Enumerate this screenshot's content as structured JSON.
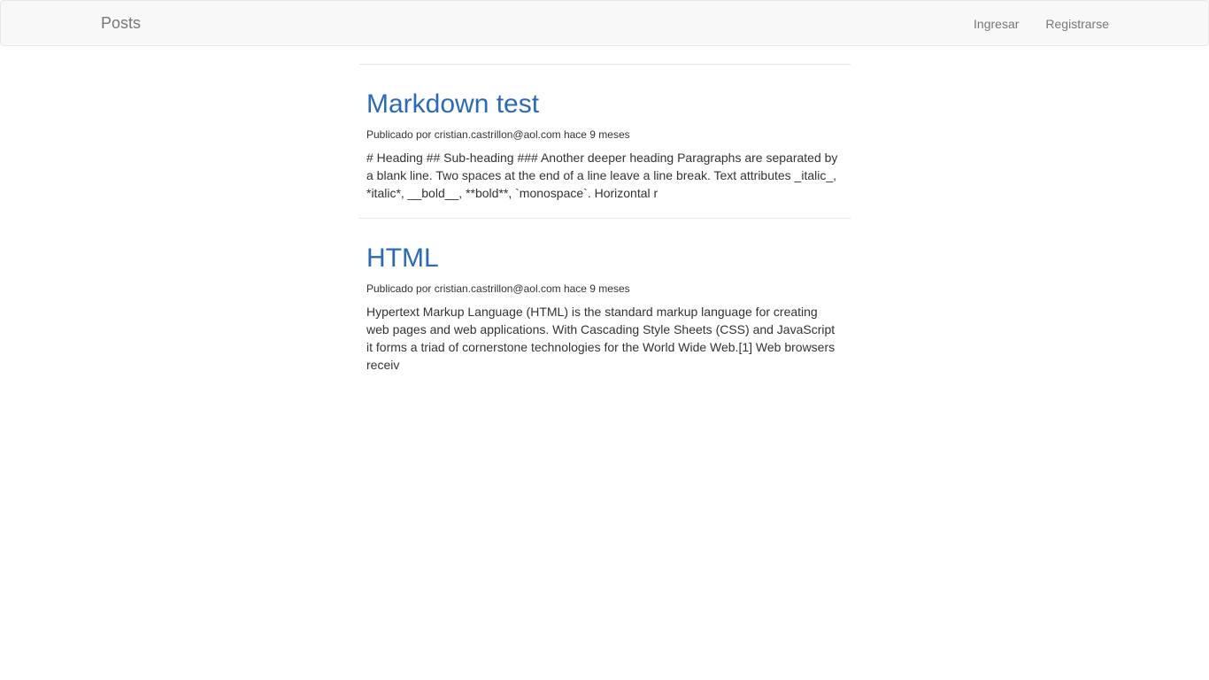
{
  "navbar": {
    "brand": "Posts",
    "links": [
      "Ingresar",
      "Registrarse"
    ]
  },
  "posts": [
    {
      "title": "Markdown test",
      "meta": "Publicado por cristian.castrillon@aol.com hace 9 meses",
      "excerpt": "# Heading ## Sub-heading ### Another deeper heading Paragraphs are separated by a blank line. Two spaces at the end of a line leave a line break. Text attributes _italic_, *italic*, __bold__, **bold**, `monospace`. Horizontal r"
    },
    {
      "title": "HTML",
      "meta": "Publicado por cristian.castrillon@aol.com hace 9 meses",
      "excerpt": "Hypertext Markup Language (HTML) is the standard markup language for creating web pages and web applications. With Cascading Style Sheets (CSS) and JavaScript it forms a triad of cornerstone technologies for the World Wide Web.[1] Web browsers receiv"
    }
  ]
}
